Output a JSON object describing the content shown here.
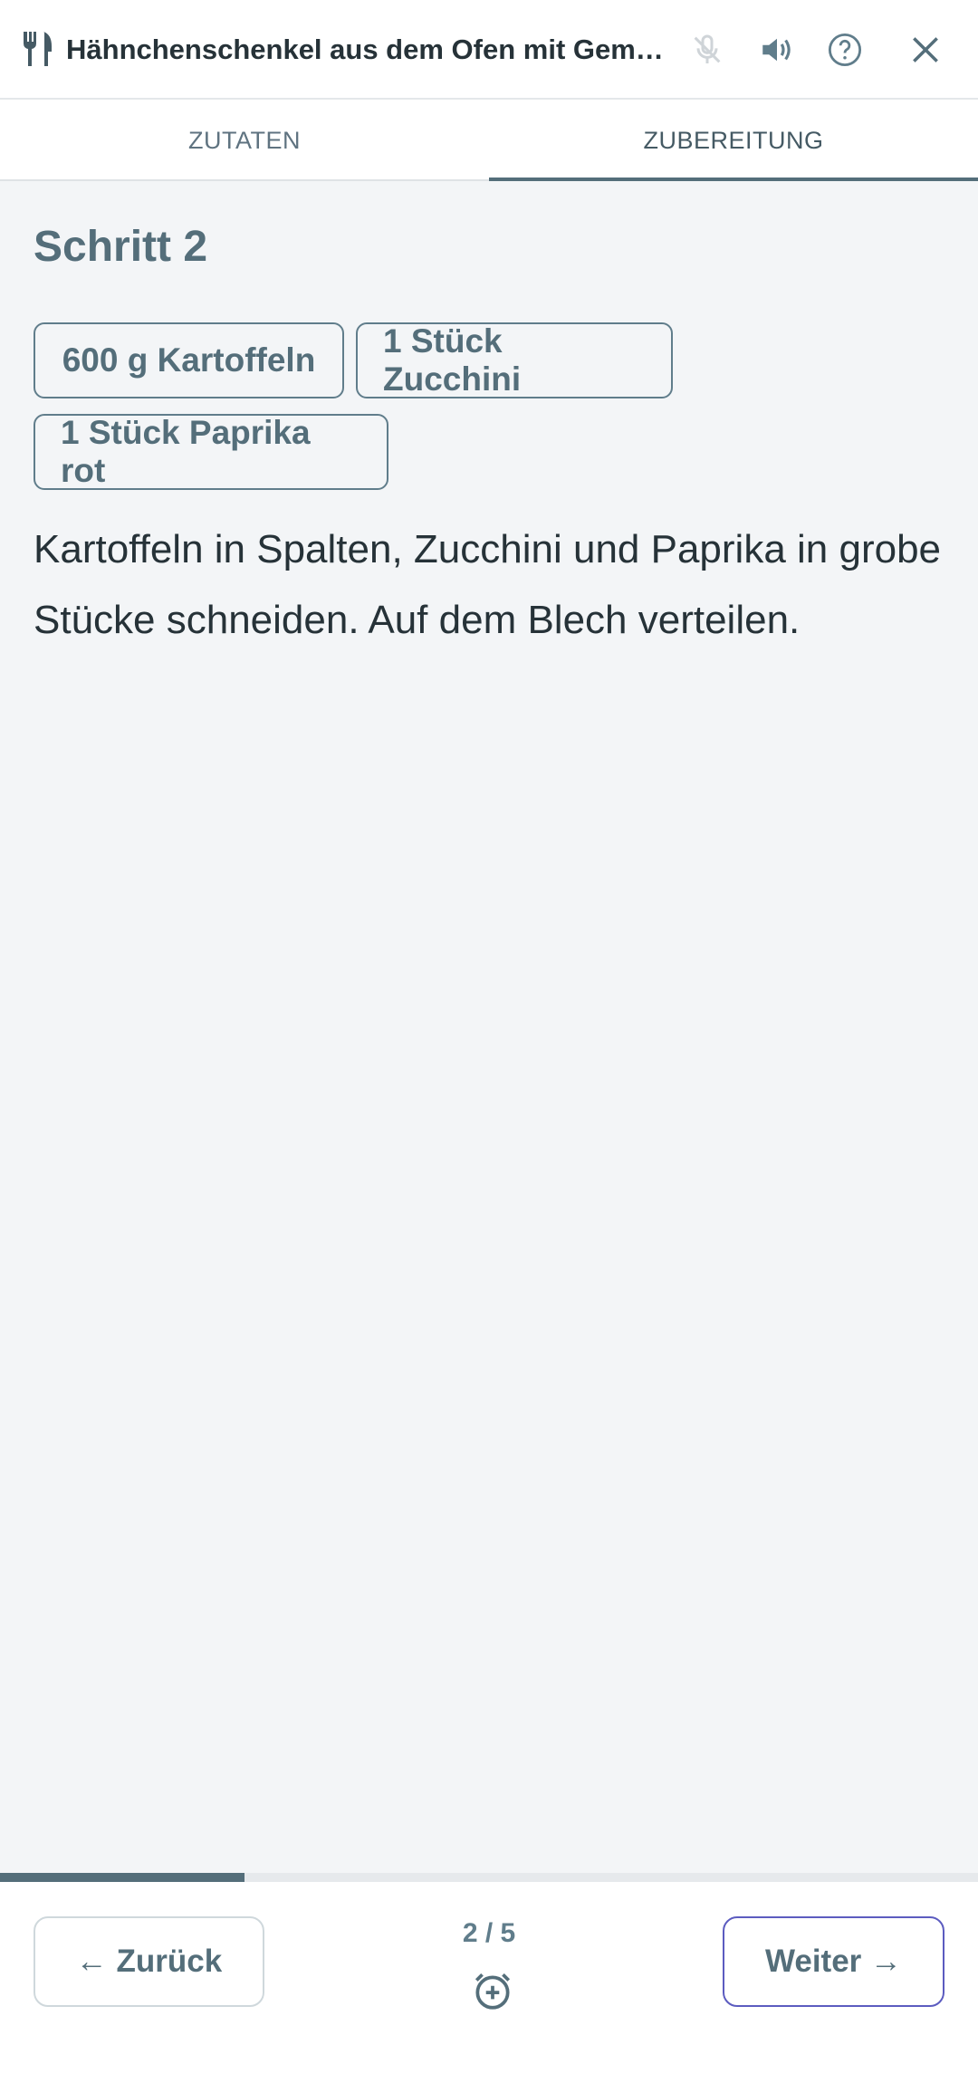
{
  "header": {
    "title": "Hähnchenschenkel aus dem Ofen mit Gemüse",
    "icons": [
      "cutlery-icon",
      "mic-off-icon",
      "volume-icon",
      "help-icon",
      "close-icon"
    ]
  },
  "tabs": [
    {
      "label": "ZUTATEN",
      "active": false
    },
    {
      "label": "ZUBEREITUNG",
      "active": true
    }
  ],
  "step": {
    "title": "Schritt 2",
    "ingredients": [
      "600 g Kartoffeln",
      "1 Stück Zucchini",
      "1 Stück Paprika rot"
    ],
    "instruction": "Kartoffeln in Spalten, Zucchini und Paprika in grobe Stücke schneiden. Auf dem Blech verteilen."
  },
  "progress": {
    "current": 2,
    "total": 5,
    "fraction": 0.25
  },
  "footer": {
    "back_label": "← Zurück",
    "next_label": "Weiter →",
    "counter": "2 / 5",
    "timer_icon": "add-alarm-icon"
  },
  "colors": {
    "accent": "#546e7a",
    "next_border": "#5c5cc0",
    "background": "#f3f5f7"
  }
}
